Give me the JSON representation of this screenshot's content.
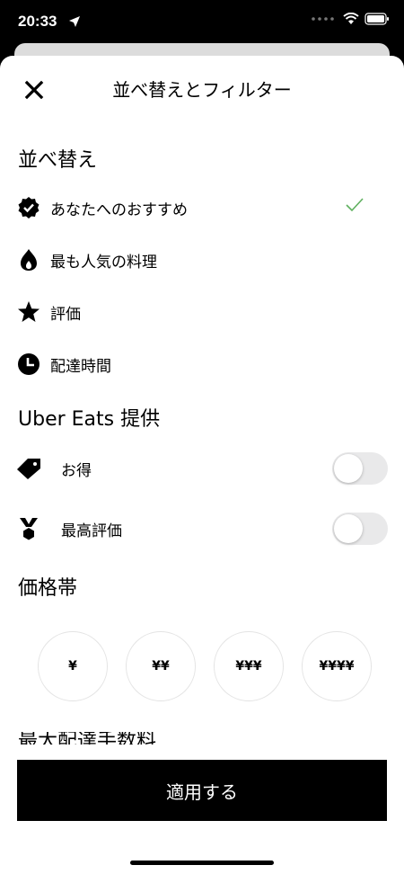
{
  "status_bar": {
    "time": "20:33"
  },
  "header": {
    "title": "並べ替えとフィルター"
  },
  "sort": {
    "title": "並べ替え",
    "options": [
      {
        "label": "あなたへのおすすめ",
        "icon": "check-badge-icon",
        "selected": true
      },
      {
        "label": "最も人気の料理",
        "icon": "flame-icon",
        "selected": false
      },
      {
        "label": "評価",
        "icon": "star-icon",
        "selected": false
      },
      {
        "label": "配達時間",
        "icon": "clock-icon",
        "selected": false
      }
    ]
  },
  "offers": {
    "title": "Uber Eats 提供",
    "items": [
      {
        "label": "お得",
        "icon": "tag-icon",
        "enabled": false
      },
      {
        "label": "最高評価",
        "icon": "medal-icon",
        "enabled": false
      }
    ]
  },
  "price_range": {
    "title": "価格帯",
    "options": [
      "¥",
      "¥¥",
      "¥¥¥",
      "¥¥¥¥"
    ]
  },
  "max_delivery_fee": {
    "title": "最大配達手数料"
  },
  "apply_button": {
    "label": "適用する"
  },
  "colors": {
    "accent_check": "#5fb05f",
    "toggle_off": "#e9e9ea"
  }
}
